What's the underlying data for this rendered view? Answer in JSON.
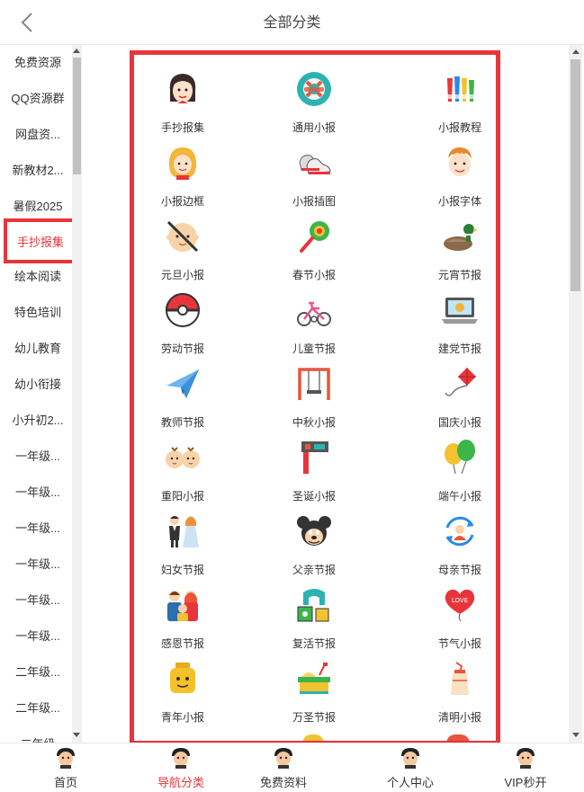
{
  "header": {
    "title": "全部分类"
  },
  "sidebar": {
    "items": [
      {
        "label": "免费资源",
        "active": false
      },
      {
        "label": "QQ资源群",
        "active": false
      },
      {
        "label": "网盘资...",
        "active": false
      },
      {
        "label": "新教材2...",
        "active": false
      },
      {
        "label": "暑假2025",
        "active": false
      },
      {
        "label": "手抄报集",
        "active": true
      },
      {
        "label": "绘本阅读",
        "active": false
      },
      {
        "label": "特色培训",
        "active": false
      },
      {
        "label": "幼儿教育",
        "active": false
      },
      {
        "label": "幼小衔接",
        "active": false
      },
      {
        "label": "小升初2...",
        "active": false
      },
      {
        "label": "一年级...",
        "active": false
      },
      {
        "label": "一年级...",
        "active": false
      },
      {
        "label": "一年级...",
        "active": false
      },
      {
        "label": "一年级...",
        "active": false
      },
      {
        "label": "一年级...",
        "active": false
      },
      {
        "label": "一年级...",
        "active": false
      },
      {
        "label": "二年级...",
        "active": false
      },
      {
        "label": "二年级...",
        "active": false
      },
      {
        "label": "二年级",
        "active": false
      }
    ]
  },
  "grid": {
    "items": [
      {
        "label": "手抄报集",
        "icon": "girl-face-icon"
      },
      {
        "label": "通用小报",
        "icon": "lifebuoy-icon"
      },
      {
        "label": "小报教程",
        "icon": "crayons-icon"
      },
      {
        "label": "小报边框",
        "icon": "blonde-girl-icon"
      },
      {
        "label": "小报插图",
        "icon": "sneakers-icon"
      },
      {
        "label": "小报字体",
        "icon": "boy-face-icon"
      },
      {
        "label": "元旦小报",
        "icon": "baby-face-icon"
      },
      {
        "label": "春节小报",
        "icon": "rattle-icon"
      },
      {
        "label": "元宵节报",
        "icon": "duck-icon"
      },
      {
        "label": "劳动节报",
        "icon": "pokeball-icon"
      },
      {
        "label": "儿童节报",
        "icon": "tricycle-icon"
      },
      {
        "label": "建党节报",
        "icon": "laptop-icon"
      },
      {
        "label": "教师节报",
        "icon": "paper-plane-icon"
      },
      {
        "label": "中秋小报",
        "icon": "swing-icon"
      },
      {
        "label": "国庆小报",
        "icon": "kite-icon"
      },
      {
        "label": "重阳小报",
        "icon": "twins-icon"
      },
      {
        "label": "圣诞小报",
        "icon": "tool-icon"
      },
      {
        "label": "端午小报",
        "icon": "balloons-icon"
      },
      {
        "label": "妇女节报",
        "icon": "couple-icon"
      },
      {
        "label": "父亲节报",
        "icon": "mouse-icon"
      },
      {
        "label": "母亲节报",
        "icon": "refresh-person-icon"
      },
      {
        "label": "感恩节报",
        "icon": "family-icon"
      },
      {
        "label": "复活节报",
        "icon": "blocks-icon"
      },
      {
        "label": "节气小报",
        "icon": "love-balloon-icon"
      },
      {
        "label": "青年小报",
        "icon": "lego-head-icon"
      },
      {
        "label": "万圣节报",
        "icon": "sandbox-icon"
      },
      {
        "label": "清明小报",
        "icon": "bottle-icon"
      }
    ]
  },
  "tabbar": {
    "items": [
      {
        "label": "首页",
        "active": false
      },
      {
        "label": "导航分类",
        "active": true
      },
      {
        "label": "免费资料",
        "active": false
      },
      {
        "label": "个人中心",
        "active": false
      },
      {
        "label": "VIP秒开",
        "active": false
      }
    ]
  },
  "colors": {
    "accent": "#e8353b",
    "text": "#333333"
  }
}
